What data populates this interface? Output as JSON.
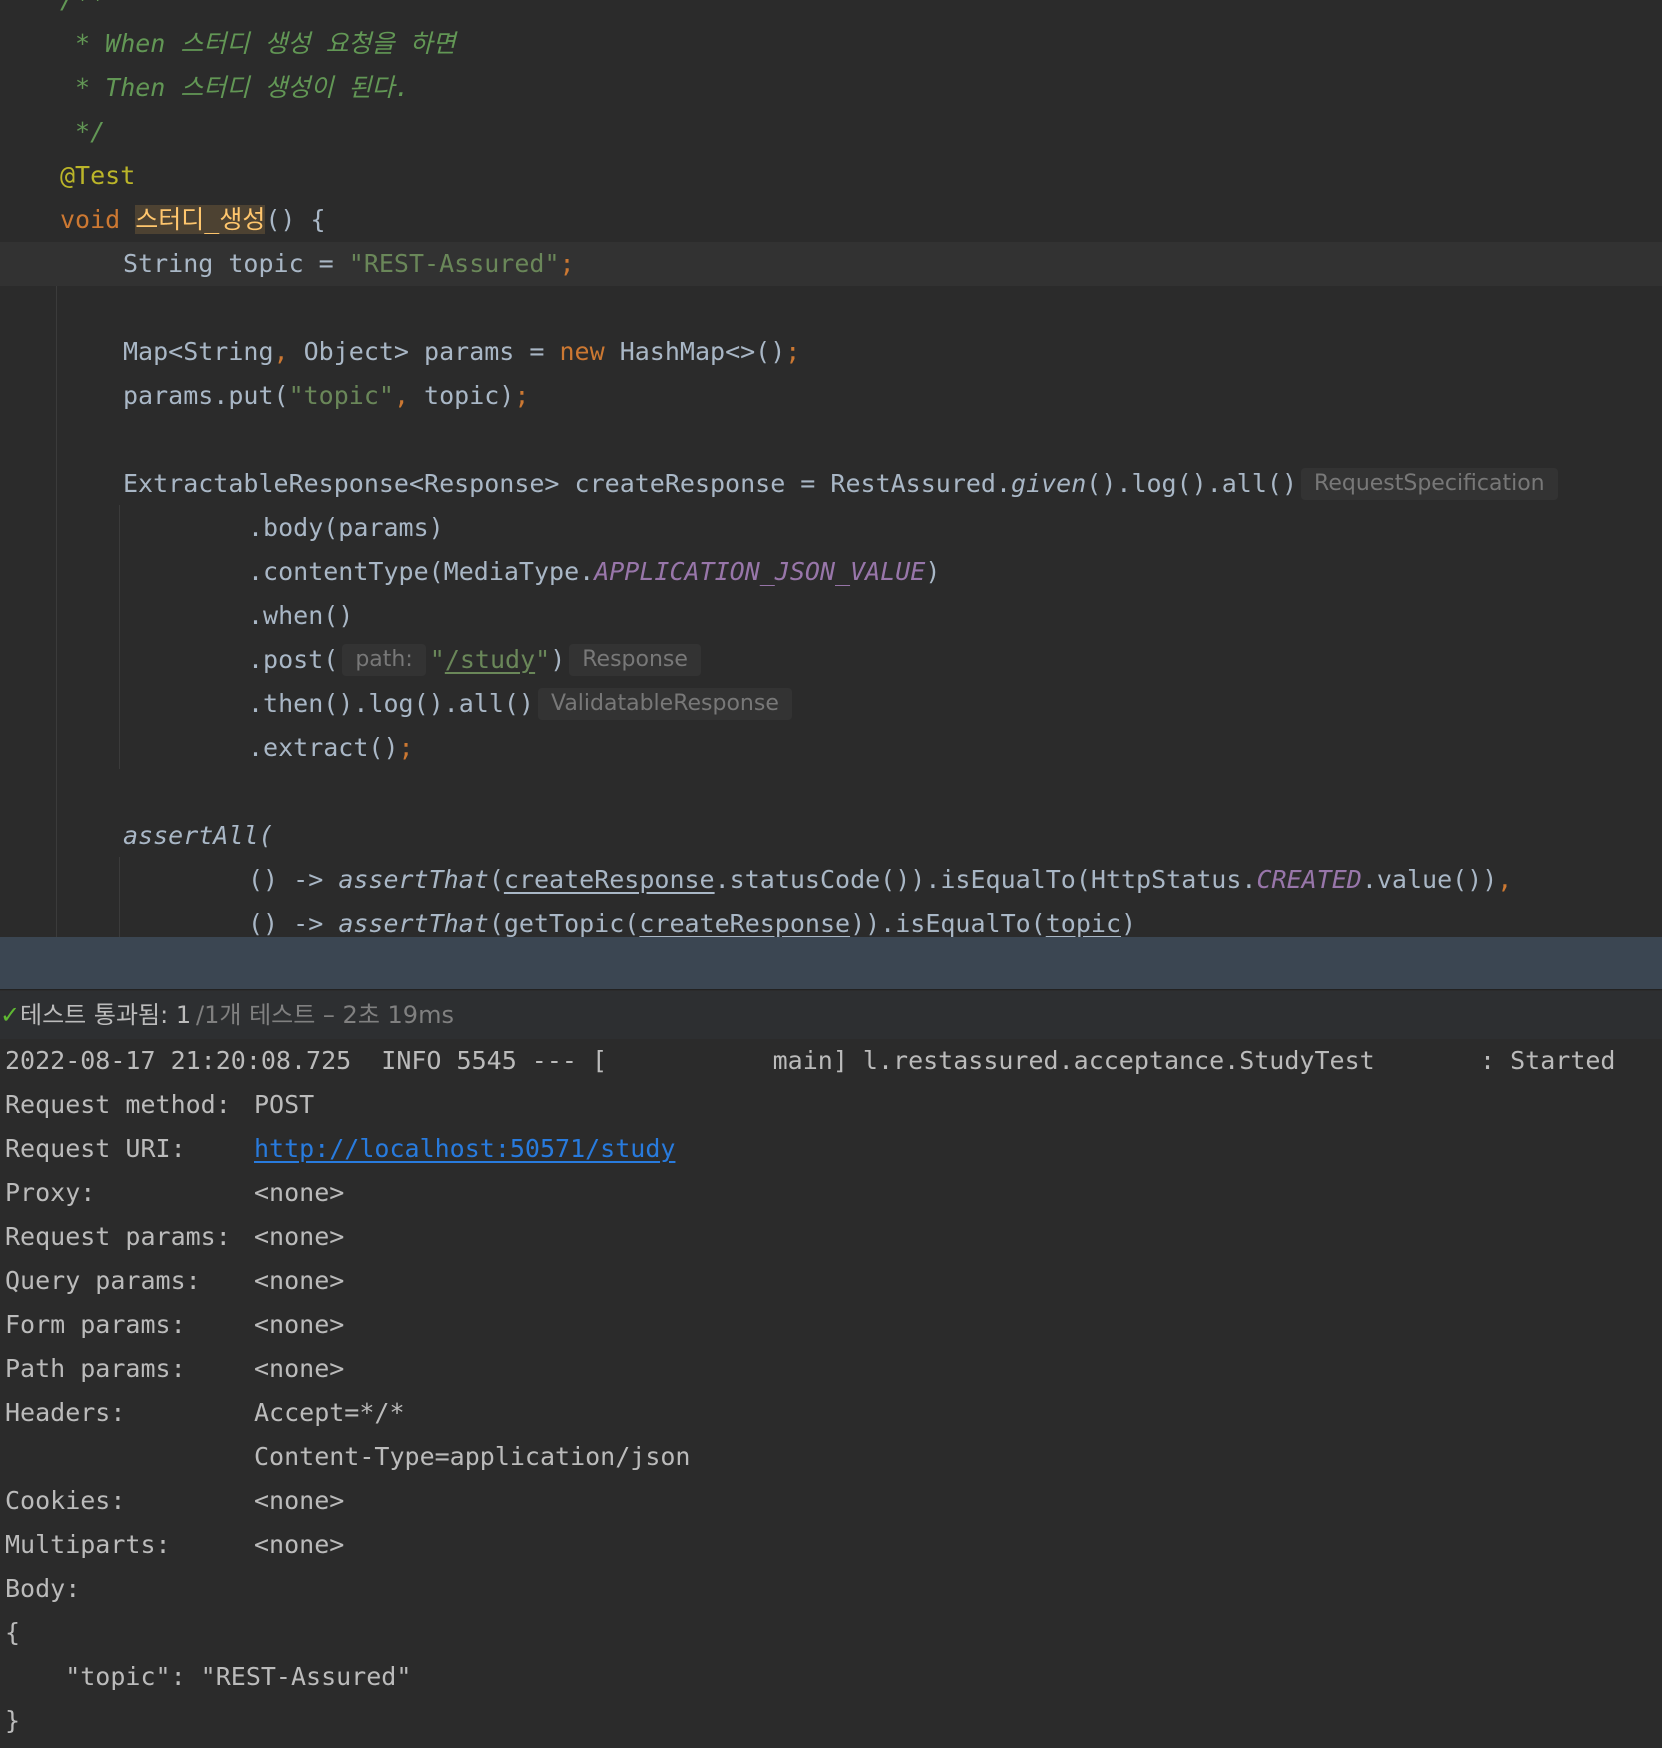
{
  "editor": {
    "comment_open": "/**",
    "comment_when": " * When 스터디 생성 요청을 하면",
    "comment_then": " * Then 스터디 생성이 된다.",
    "comment_close": " */",
    "annotation": "@Test",
    "method_void": "void",
    "method_name": "스터디_생성",
    "method_tail": "() {",
    "l_topic_type": "String topic = ",
    "l_topic_str": "\"REST-Assured\"",
    "semi": ";",
    "l_map_a": "Map<String",
    "comma": ", ",
    "l_map_b": "Object> params = ",
    "kw_new": "new",
    "l_map_c": " HashMap<>()",
    "l_put_a": "params.put(",
    "l_put_str": "\"topic\"",
    "l_put_b": "topic)",
    "l_er_a": "ExtractableResponse<Response> createResponse = RestAssured.",
    "l_er_given": "given",
    "l_er_b": "().log().all()",
    "hint_request_spec": "RequestSpecification",
    "l_body": ".body(params)",
    "l_ct_a": ".contentType(MediaType.",
    "l_ct_const": "APPLICATION_JSON_VALUE",
    "l_ct_b": ")",
    "l_when": ".when()",
    "l_post_a": ".post(",
    "hint_path": "path:",
    "l_post_q1": "\"",
    "l_post_path": "/study",
    "l_post_q2": "\"",
    "l_post_b": ")",
    "hint_response": "Response",
    "l_then": ".then().log().all()",
    "hint_validatable": "ValidatableResponse",
    "l_extract": ".extract()",
    "l_assertall": "assertAll(",
    "a1_lambda": "() -> ",
    "a1_assert": "assertThat",
    "a1_paren": "(",
    "a1_var": "createResponse",
    "a1_b": ".statusCode()).isEqualTo(HttpStatus.",
    "a1_const": "CREATED",
    "a1_c": ".value())",
    "a1_comma": ",",
    "a2_lambda": "() -> ",
    "a2_assert": "assertThat",
    "a2_b": "(getTopic(",
    "a2_var": "createResponse",
    "a2_c": ")).isEqualTo(",
    "a2_var2": "topic",
    "a2_d": ")"
  },
  "test_status": {
    "passed": "테스트 통과됨: 1",
    "detail": "/1개 테스트 – 2초 19ms"
  },
  "console": {
    "log_line": "2022-08-17 21:20:08.725  INFO 5545 --- [           main] l.restassured.acceptance.StudyTest       : Started",
    "request_method_label": "Request method:",
    "request_method_value": "POST",
    "request_uri_label": "Request URI:",
    "request_uri_value": "http://localhost:50571/study",
    "proxy_label": "Proxy:",
    "proxy_value": "<none>",
    "request_params_label": "Request params:",
    "request_params_value": "<none>",
    "query_params_label": "Query params:",
    "query_params_value": "<none>",
    "form_params_label": "Form params:",
    "form_params_value": "<none>",
    "path_params_label": "Path params:",
    "path_params_value": "<none>",
    "headers_label": "Headers:",
    "headers_value_1": "Accept=*/*",
    "headers_value_2": "Content-Type=application/json",
    "cookies_label": "Cookies:",
    "cookies_value": "<none>",
    "multiparts_label": "Multiparts:",
    "multiparts_value": "<none>",
    "body_label": "Body:",
    "body_open": "{",
    "body_content": "    \"topic\": \"REST-Assured\"",
    "body_close": "}"
  },
  "colors": {
    "background": "#2b2b2b",
    "comment": "#629755",
    "keyword": "#cc7832",
    "annotation": "#bbb529",
    "string": "#6a8759",
    "static_member": "#9876aa",
    "link": "#287bde",
    "test_passed": "#5fb832"
  }
}
